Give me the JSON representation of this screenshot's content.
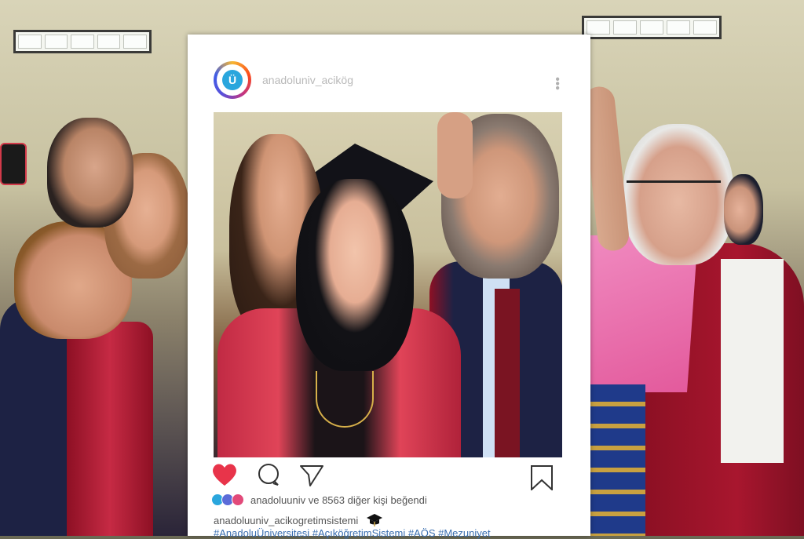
{
  "post": {
    "username_top": "anadoluniv_acikög",
    "likes_text": "anadoluuniv ve 8563 diğer kişi beğendi",
    "caption_user": "anadoluuniv_acikogretimsistemi",
    "hashtags": "#AnadoluÜniversitesi #AçıköğretimSistemi #AÖS #Mezuniyet"
  },
  "icons": {
    "like": "heart-icon",
    "comment": "comment-icon",
    "share": "send-icon",
    "save": "bookmark-icon",
    "more": "more-icon",
    "graduation": "graduation-cap-icon"
  },
  "colors": {
    "heart": "#e8344a",
    "hashtag": "#3b6fb0",
    "gown_red": "#a8162e",
    "gown_navy": "#1d2244",
    "sash_pink": "#e96aa8"
  }
}
